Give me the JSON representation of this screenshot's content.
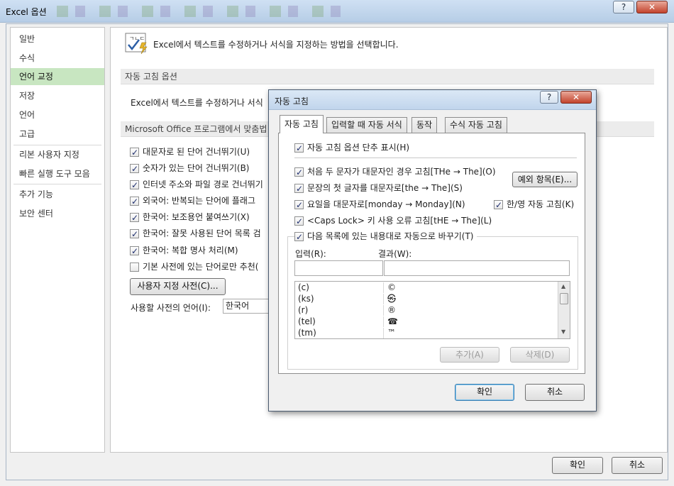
{
  "window": {
    "title": "Excel 옵션",
    "help": "?",
    "close": "✕"
  },
  "sidebar": {
    "items": [
      "일반",
      "수식",
      "언어 교정",
      "저장",
      "언어",
      "고급",
      "리본 사용자 지정",
      "빠른 실행 도구 모음",
      "추가 기능",
      "보안 센터"
    ],
    "active_index": 2
  },
  "main": {
    "header_text": "Excel에서 텍스트를 수정하거나 서식을 지정하는 방법을 선택합니다.",
    "section1_title": "자동 고침 옵션",
    "section1_desc": "Excel에서 텍스트를 수정하거나 서식",
    "section2_title": "Microsoft Office 프로그램에서 맞춤법",
    "options": [
      {
        "label": "대문자로 된 단어 건너뛰기(U)",
        "checked": true
      },
      {
        "label": "숫자가 있는 단어 건너뛰기(B)",
        "checked": true
      },
      {
        "label": "인터넷 주소와 파일 경로 건너뛰기",
        "checked": true
      },
      {
        "label": "외국어: 반복되는 단어에 플래그",
        "checked": true
      },
      {
        "label": "한국어: 보조용언 붙여쓰기(X)",
        "checked": true
      },
      {
        "label": "한국어: 잘못 사용된 단어 목록 검",
        "checked": true
      },
      {
        "label": "한국어: 복합 명사 처리(M)",
        "checked": true
      },
      {
        "label": "기본 사전에 있는 단어로만 추천(",
        "checked": false
      }
    ],
    "custom_dict_button": "사용자 지정 사전(C)...",
    "dict_lang_label": "사용할 사전의 언어(I):",
    "dict_lang_value": "한국어"
  },
  "footer": {
    "ok": "확인",
    "cancel": "취소"
  },
  "dialog": {
    "title": "자동 고침",
    "help": "?",
    "close": "✕",
    "tabs": [
      "자동 고침",
      "입력할 때 자동 서식",
      "동작",
      "수식 자동 고침"
    ],
    "active_tab": 0,
    "show_buttons": {
      "label": "자동 고침 옵션 단추 표시(H)",
      "checked": true
    },
    "options": [
      {
        "label": "처음 두 문자가 대문자인 경우 고침[THe → The](O)",
        "checked": true
      },
      {
        "label": "문장의 첫 글자를 대문자로[the → The](S)",
        "checked": true
      },
      {
        "label": "요일을 대문자로[monday → Monday](N)",
        "checked": true
      },
      {
        "label": "<Caps Lock> 키 사용 오류 고침[tHE → The](L)",
        "checked": true
      }
    ],
    "korean_english": {
      "label": "한/영 자동 고침(K)",
      "checked": true
    },
    "exceptions_button": "예외 항목(E)...",
    "replace": {
      "label": "다음 목록에 있는 내용대로 자동으로 바꾸기(T)",
      "checked": true
    },
    "input_label": "입력(R):",
    "result_label": "결과(W):",
    "input_value": "",
    "result_value": "",
    "list": [
      {
        "from": "(c)",
        "to": "©"
      },
      {
        "from": "(ks)",
        "to": "㉿"
      },
      {
        "from": "(r)",
        "to": "®"
      },
      {
        "from": "(tel)",
        "to": "☎"
      },
      {
        "from": "(tm)",
        "to": "™"
      }
    ],
    "add_button": "추가(A)",
    "delete_button": "삭제(D)",
    "ok": "확인",
    "cancel": "취소"
  }
}
